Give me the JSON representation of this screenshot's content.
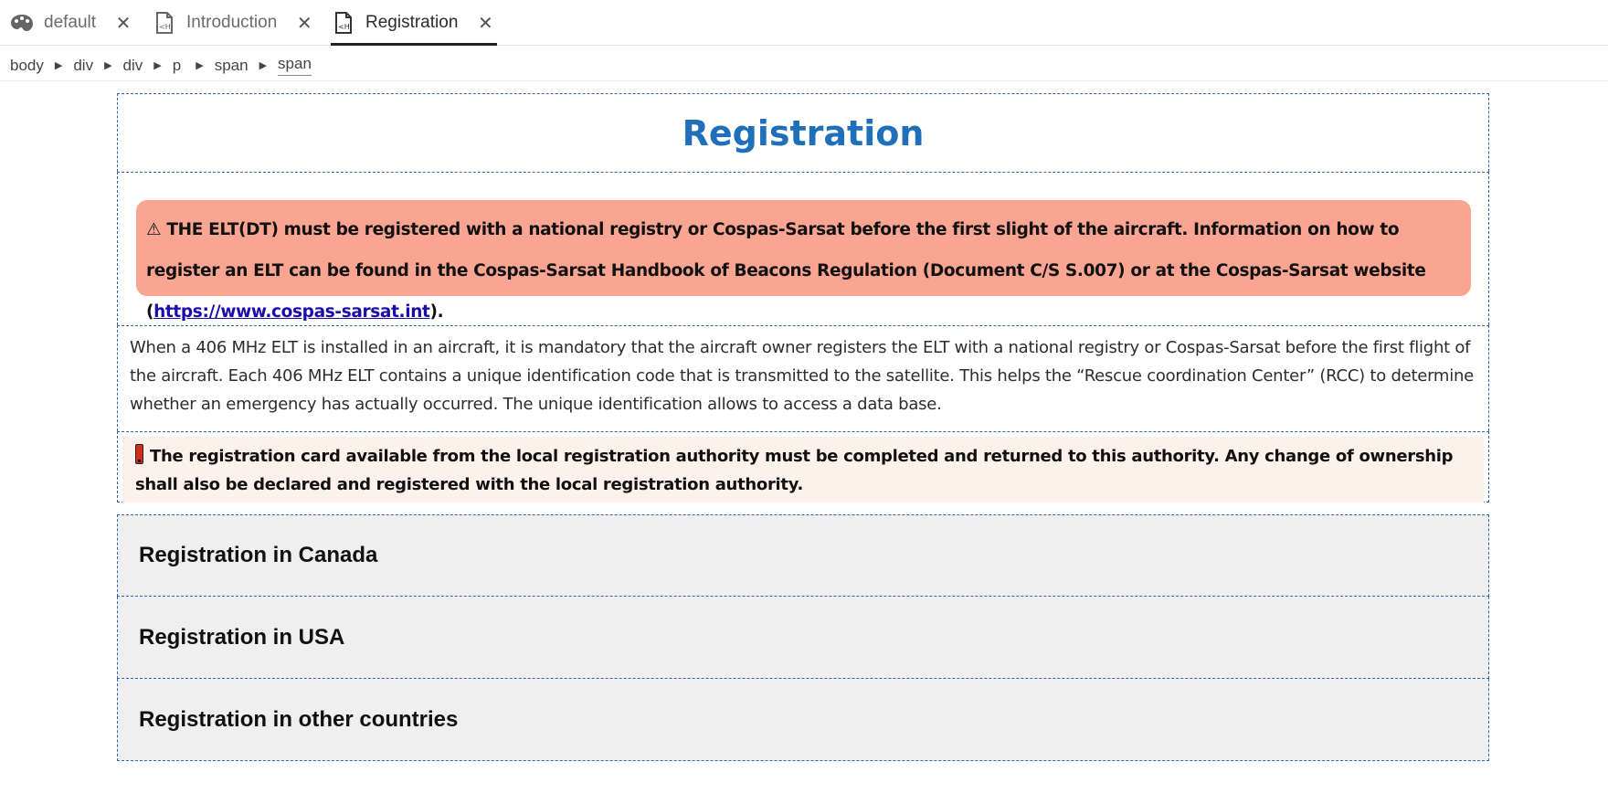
{
  "tabs": [
    {
      "label": "default",
      "icon": "palette-icon",
      "active": false
    },
    {
      "label": "Introduction",
      "icon": "html-file-icon",
      "active": false
    },
    {
      "label": "Registration",
      "icon": "html-file-icon",
      "active": true
    }
  ],
  "close_glyph": "✕",
  "breadcrumb": [
    "body",
    "div",
    "div",
    "p",
    "span",
    "span"
  ],
  "document": {
    "title": "Registration",
    "warning": {
      "icon": "warning-triangle-icon",
      "glyph": "⚠",
      "text": "THE ELT(DT) must be registered with a national registry or Cospas-Sarsat before the first slight of the aircraft. Information on how to register an ELT can be found in the Cospas-Sarsat Handbook of Beacons Regulation (Document C/S S.007) or at the Cospas-Sarsat website (",
      "link": "https://www.cospas-sarsat.int",
      "after": ")."
    },
    "paragraph": "When a 406 MHz ELT is installed in an aircraft, it is mandatory that the aircraft owner registers the ELT with a national registry or Cospas-Sarsat before the first flight of the aircraft. Each 406 MHz ELT contains a unique identification code that is transmitted to the satellite. This helps the “Rescue coordination Center” (RCC) to determine whether an emergency has actually occurred. The unique identification allows to access a data base.",
    "note": {
      "icon": "exclamation-icon",
      "text": "The registration card available from the local registration authority must be completed and returned to this authority. Any change of ownership shall also be declared and registered with the local registration authority."
    },
    "sections": [
      "Registration in Canada",
      "Registration in USA",
      "Registration in other countries"
    ]
  },
  "colors": {
    "title": "#1f6fba",
    "warning_bg": "#f9a592",
    "note_bg": "#fdf2eb",
    "section_bg": "#efefef",
    "block_border": "#2f67b1",
    "link": "#1a0dab"
  }
}
